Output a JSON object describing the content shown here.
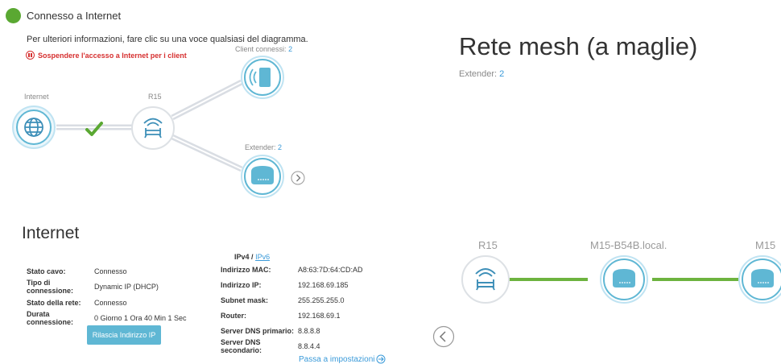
{
  "status": {
    "title": "Connesso a Internet",
    "info": "Per ulteriori informazioni, fare clic su una voce qualsiasi del diagramma.",
    "suspend_link": "Sospendere l'accesso a Internet per i client",
    "color": "#5aa832"
  },
  "diagram": {
    "internet_label": "Internet",
    "router_label": "R15",
    "clients_label": "Client connessi:",
    "clients_count": "2",
    "extender_label": "Extender:",
    "extender_count": "2"
  },
  "internet": {
    "title": "Internet",
    "left": [
      {
        "label": "Stato cavo:",
        "value": "Connesso"
      },
      {
        "label": "Tipo di connessione:",
        "value": "Dynamic IP (DHCP)"
      },
      {
        "label": "Stato della rete:",
        "value": "Connesso"
      },
      {
        "label": "Durata connessione:",
        "value": "0 Giorno 1 Ora 40 Min 1 Sec"
      }
    ],
    "ipv4_tab": "IPv4",
    "tab_separator": "/",
    "ipv6_tab": "IPv6",
    "right": [
      {
        "label": "Indirizzo MAC:",
        "value": "A8:63:7D:64:CD:AD"
      },
      {
        "label": "Indirizzo IP:",
        "value": "192.168.69.185"
      },
      {
        "label": "Subnet mask:",
        "value": "255.255.255.0"
      },
      {
        "label": "Router:",
        "value": "192.168.69.1"
      },
      {
        "label": "Server DNS primario:",
        "value": "8.8.8.8"
      },
      {
        "label": "Server DNS secondario:",
        "value": "8.8.4.4"
      }
    ],
    "release_button": "Rilascia Indirizzo IP",
    "settings_link": "Passa a impostazioni"
  },
  "mesh": {
    "title": "Rete mesh (a maglie)",
    "extender_label": "Extender:",
    "extender_count": "2",
    "nodes": [
      "R15",
      "M15-B54B.local.",
      "M15"
    ]
  },
  "colors": {
    "accent": "#5fb7d4",
    "link": "#3a9ad9",
    "mesh_line": "#6db33f",
    "warning": "#d63030"
  }
}
